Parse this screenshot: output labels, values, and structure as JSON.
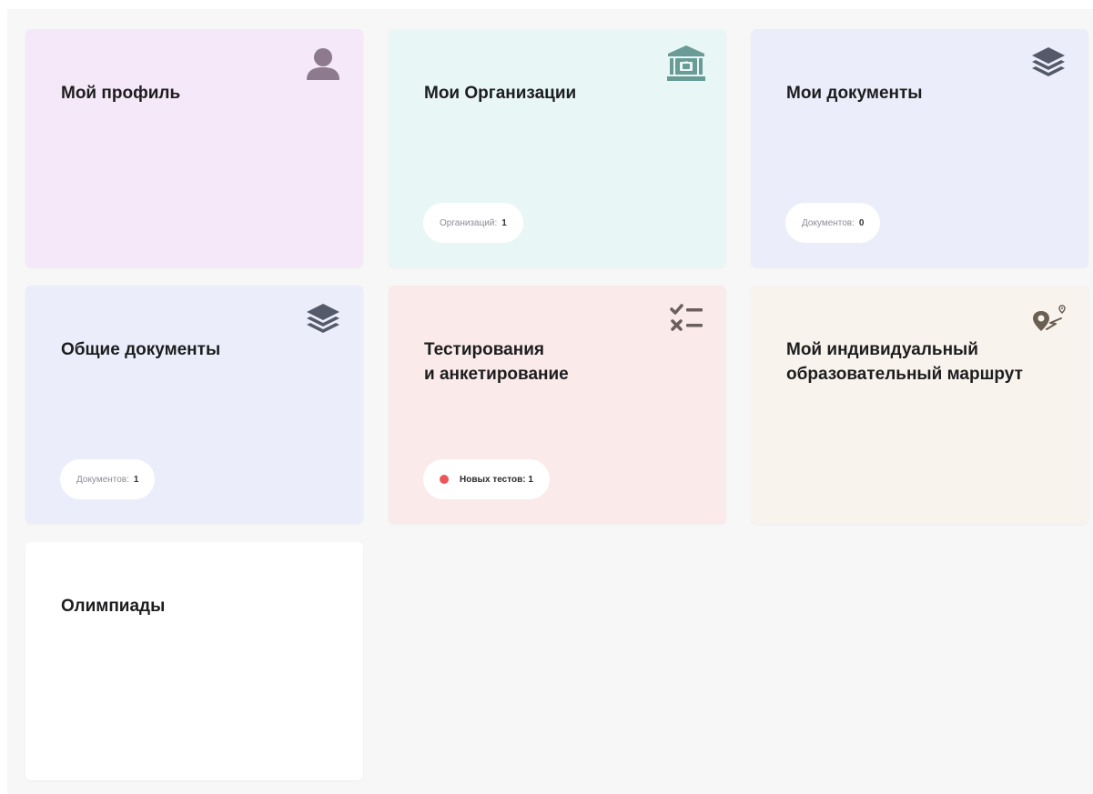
{
  "colors": {
    "profile_bg": "#f5e8f8",
    "orgs_bg": "#e8f7f6",
    "docs_bg": "#ebeefa",
    "shared_docs_bg": "#ebeefa",
    "tests_bg": "#faeaea",
    "route_bg": "#f8f3ec",
    "olympiads_bg": "#ffffff",
    "profile_icon": "#8e7a8e",
    "orgs_icon": "#6a9b96",
    "docs_icon": "#555a6b",
    "tests_icon": "#6b5e5e",
    "route_icon": "#6b5f52",
    "alert_dot": "#eb5757"
  },
  "cards": {
    "profile": {
      "title": "Мой профиль",
      "icon": "user-icon"
    },
    "organizations": {
      "title": "Мои Организации",
      "icon": "institution-icon",
      "counter_label": "Организаций:",
      "counter_value": "1"
    },
    "documents": {
      "title": "Мои документы",
      "icon": "layers-icon",
      "counter_label": "Документов:",
      "counter_value": "0"
    },
    "shared_documents": {
      "title": "Общие документы",
      "icon": "layers-icon",
      "counter_label": "Документов:",
      "counter_value": "1"
    },
    "tests": {
      "title": "Тестирования\nи анкетирование",
      "icon": "checklist-icon",
      "badge_label": "Новых тестов: 1"
    },
    "route": {
      "title": "Мой индивидуальный\nобразовательный маршрут",
      "icon": "route-pin-icon"
    },
    "olympiads": {
      "title": "Олимпиады"
    }
  }
}
